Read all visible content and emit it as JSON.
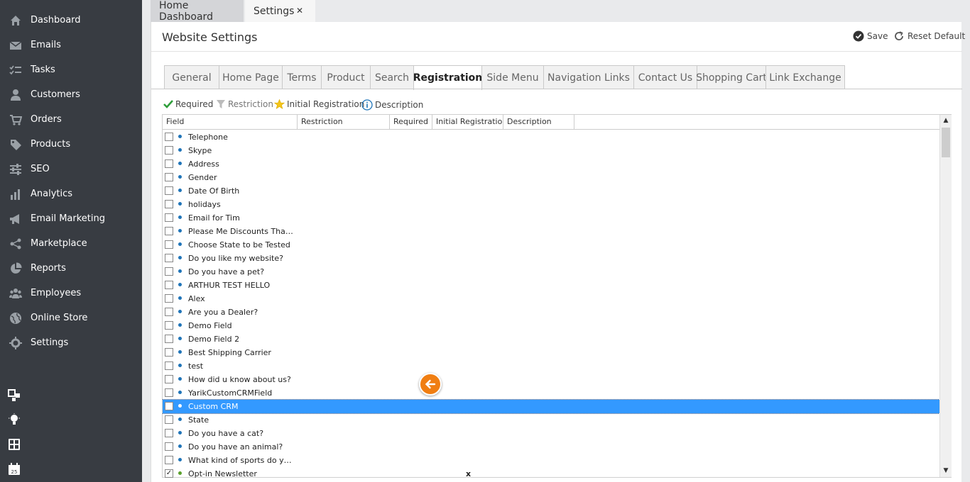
{
  "sidebar": {
    "items": [
      {
        "label": "Dashboard",
        "icon": "home-icon"
      },
      {
        "label": "Emails",
        "icon": "envelope-icon"
      },
      {
        "label": "Tasks",
        "icon": "tasks-icon"
      },
      {
        "label": "Customers",
        "icon": "user-icon"
      },
      {
        "label": "Orders",
        "icon": "cart-icon"
      },
      {
        "label": "Products",
        "icon": "tag-icon"
      },
      {
        "label": "SEO",
        "icon": "sliders-icon"
      },
      {
        "label": "Analytics",
        "icon": "bar-chart-icon"
      },
      {
        "label": "Email Marketing",
        "icon": "megaphone-icon"
      },
      {
        "label": "Marketplace",
        "icon": "share-icon"
      },
      {
        "label": "Reports",
        "icon": "pie-chart-icon"
      },
      {
        "label": "Employees",
        "icon": "group-icon"
      },
      {
        "label": "Online Store",
        "icon": "globe-icon"
      },
      {
        "label": "Settings",
        "icon": "gear-icon"
      }
    ],
    "tools": [
      "widgets-icon",
      "lightbulb-icon",
      "calculator-icon",
      "calendar-icon"
    ],
    "calendar_day": "25"
  },
  "tabs": {
    "home": "Home Dashboard",
    "settings": "Settings",
    "close": "✕"
  },
  "header": {
    "title": "Website Settings",
    "save": "Save",
    "reset": "Reset Default"
  },
  "settings_tabs": [
    "General",
    "Home Page",
    "Terms",
    "Product",
    "Search",
    "Registration",
    "Side Menu",
    "Navigation Links",
    "Contact Us",
    "Shopping Cart",
    "Link Exchange"
  ],
  "active_tab": "Registration",
  "legend": {
    "required": "Required",
    "restriction": "Restriction",
    "initial": "Initial Registration",
    "description": "Description"
  },
  "grid": {
    "columns": [
      "Field",
      "Restriction",
      "Required",
      "Initial Registratio",
      "Description"
    ],
    "rows": [
      {
        "name": "Telephone",
        "checked": false,
        "initial": ""
      },
      {
        "name": "Skype",
        "checked": false,
        "initial": ""
      },
      {
        "name": "Address",
        "checked": false,
        "initial": ""
      },
      {
        "name": "Gender",
        "checked": false,
        "initial": ""
      },
      {
        "name": "Date Of Birth",
        "checked": false,
        "initial": ""
      },
      {
        "name": "holidays",
        "checked": false,
        "initial": ""
      },
      {
        "name": "Email for Tim",
        "checked": false,
        "initial": ""
      },
      {
        "name": "Please Me Discounts That Ar...",
        "checked": false,
        "initial": ""
      },
      {
        "name": "Choose State to be Tested",
        "checked": false,
        "initial": ""
      },
      {
        "name": "Do you like my website?",
        "checked": false,
        "initial": ""
      },
      {
        "name": "Do you have a pet?",
        "checked": false,
        "initial": ""
      },
      {
        "name": "ARTHUR TEST HELLO",
        "checked": false,
        "initial": ""
      },
      {
        "name": "Alex",
        "checked": false,
        "initial": ""
      },
      {
        "name": "Are you a Dealer?",
        "checked": false,
        "initial": ""
      },
      {
        "name": "Demo Field",
        "checked": false,
        "initial": ""
      },
      {
        "name": "Demo Field 2",
        "checked": false,
        "initial": ""
      },
      {
        "name": "Best Shipping Carrier",
        "checked": false,
        "initial": ""
      },
      {
        "name": "test",
        "checked": false,
        "initial": ""
      },
      {
        "name": "How did u know about us?",
        "checked": false,
        "initial": ""
      },
      {
        "name": "YarikCustomCRMField",
        "checked": false,
        "initial": ""
      },
      {
        "name": "Custom CRM",
        "checked": false,
        "initial": "",
        "selected": true
      },
      {
        "name": "State",
        "checked": false,
        "initial": ""
      },
      {
        "name": "Do you have a cat?",
        "checked": false,
        "initial": ""
      },
      {
        "name": "Do you have an animal?",
        "checked": false,
        "initial": ""
      },
      {
        "name": "What kind of sports do you...",
        "checked": false,
        "initial": ""
      },
      {
        "name": "Opt-in Newsletter",
        "checked": true,
        "initial": "x"
      }
    ]
  },
  "colors": {
    "sidebar": "#383c42",
    "selection": "#3399ff",
    "accent_orange": "#f07e12",
    "dot_blue": "#1f74b8"
  }
}
